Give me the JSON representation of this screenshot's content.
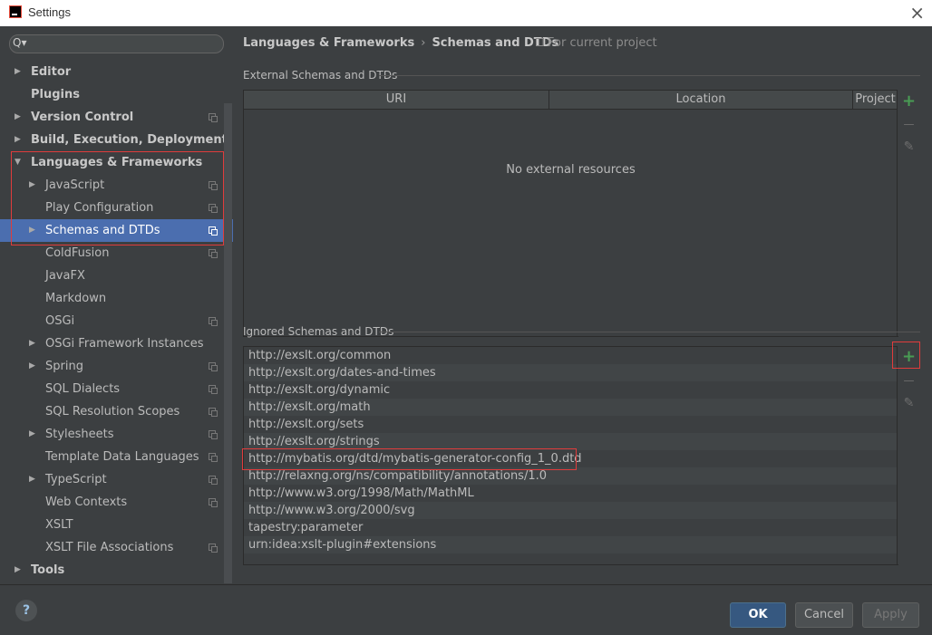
{
  "window": {
    "title": "Settings",
    "close_icon": "×"
  },
  "search": {
    "placeholder": "",
    "icon": "Q▾"
  },
  "tree": [
    {
      "label": "Editor",
      "level": 0,
      "arrow": "right",
      "bold": true,
      "project": false
    },
    {
      "label": "Plugins",
      "level": 0,
      "arrow": "",
      "bold": true,
      "project": false
    },
    {
      "label": "Version Control",
      "level": 0,
      "arrow": "right",
      "bold": true,
      "project": true
    },
    {
      "label": "Build, Execution, Deployment",
      "level": 0,
      "arrow": "right",
      "bold": true,
      "project": false
    },
    {
      "label": "Languages & Frameworks",
      "level": 0,
      "arrow": "down",
      "bold": true,
      "project": false
    },
    {
      "label": "JavaScript",
      "level": 1,
      "arrow": "right",
      "bold": false,
      "project": true
    },
    {
      "label": "Play Configuration",
      "level": 1,
      "arrow": "",
      "bold": false,
      "project": true
    },
    {
      "label": "Schemas and DTDs",
      "level": 1,
      "arrow": "right",
      "bold": false,
      "project": true,
      "selected": true
    },
    {
      "label": "ColdFusion",
      "level": 1,
      "arrow": "",
      "bold": false,
      "project": true
    },
    {
      "label": "JavaFX",
      "level": 1,
      "arrow": "",
      "bold": false,
      "project": false
    },
    {
      "label": "Markdown",
      "level": 1,
      "arrow": "",
      "bold": false,
      "project": false
    },
    {
      "label": "OSGi",
      "level": 1,
      "arrow": "",
      "bold": false,
      "project": true
    },
    {
      "label": "OSGi Framework Instances",
      "level": 1,
      "arrow": "right",
      "bold": false,
      "project": false
    },
    {
      "label": "Spring",
      "level": 1,
      "arrow": "right",
      "bold": false,
      "project": true
    },
    {
      "label": "SQL Dialects",
      "level": 1,
      "arrow": "",
      "bold": false,
      "project": true
    },
    {
      "label": "SQL Resolution Scopes",
      "level": 1,
      "arrow": "",
      "bold": false,
      "project": true
    },
    {
      "label": "Stylesheets",
      "level": 1,
      "arrow": "right",
      "bold": false,
      "project": true
    },
    {
      "label": "Template Data Languages",
      "level": 1,
      "arrow": "",
      "bold": false,
      "project": true
    },
    {
      "label": "TypeScript",
      "level": 1,
      "arrow": "right",
      "bold": false,
      "project": true
    },
    {
      "label": "Web Contexts",
      "level": 1,
      "arrow": "",
      "bold": false,
      "project": true
    },
    {
      "label": "XSLT",
      "level": 1,
      "arrow": "",
      "bold": false,
      "project": false
    },
    {
      "label": "XSLT File Associations",
      "level": 1,
      "arrow": "",
      "bold": false,
      "project": true
    },
    {
      "label": "Tools",
      "level": 0,
      "arrow": "right",
      "bold": true,
      "project": false
    }
  ],
  "breadcrumb": {
    "parent": "Languages & Frameworks",
    "separator": "›",
    "current": "Schemas and DTDs",
    "scope": "For current project"
  },
  "external": {
    "title": "External Schemas and DTDs",
    "columns": [
      "URI",
      "Location",
      "Project"
    ],
    "empty_text": "No external resources"
  },
  "ignored": {
    "title": "Ignored Schemas and DTDs",
    "items": [
      "http://exslt.org/common",
      "http://exslt.org/dates-and-times",
      "http://exslt.org/dynamic",
      "http://exslt.org/math",
      "http://exslt.org/sets",
      "http://exslt.org/strings",
      "http://mybatis.org/dtd/mybatis-generator-config_1_0.dtd",
      "http://relaxng.org/ns/compatibility/annotations/1.0",
      "http://www.w3.org/1998/Math/MathML",
      "http://www.w3.org/2000/svg",
      "tapestry:parameter",
      "urn:idea:xslt-plugin#extensions"
    ]
  },
  "toolbar": {
    "add": "+",
    "remove": "—",
    "edit": "✎"
  },
  "footer": {
    "help": "?",
    "ok": "OK",
    "cancel": "Cancel",
    "apply": "Apply"
  },
  "colors": {
    "accent": "#4b6eaf",
    "highlight": "#e03c3c",
    "add": "#499c54"
  }
}
